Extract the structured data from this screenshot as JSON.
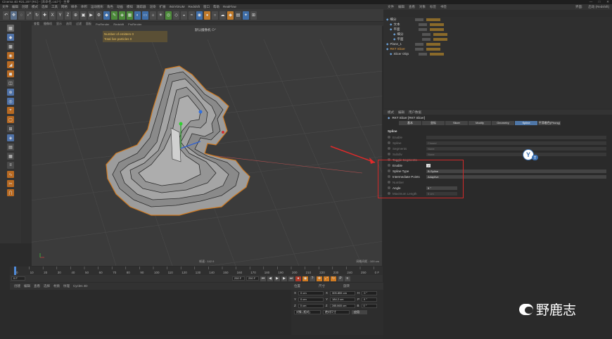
{
  "window": {
    "title": "Cinema 4D R21.207 (RC) - [未命名.c4d *] - 主要",
    "controls": [
      "—",
      "□",
      "✕"
    ]
  },
  "menubar": [
    "文件",
    "编辑",
    "创建",
    "模式",
    "选择",
    "工具",
    "网格",
    "样条",
    "体积",
    "运动图形",
    "角色",
    "动画",
    "模拟",
    "跟踪器",
    "渲染",
    "扩展",
    "INSYDIUM",
    "Redshift",
    "窗口",
    "帮助",
    "RealFlow"
  ],
  "viewport": {
    "menu": [
      "查看",
      "摄像机",
      "显示",
      "选项",
      "过滤",
      "面板",
      "ProRender",
      "Redshift",
      "ProRender"
    ],
    "camera": "默认摄像机 ⊙°",
    "hud": [
      "Number of emitters 0",
      "Total live particles 0"
    ],
    "status": "帧速 : 142.9",
    "grid_spacing": "网格间距 : 100 cm"
  },
  "timeline": {
    "ticks": [
      "0",
      "10",
      "20",
      "30",
      "40",
      "50",
      "60",
      "70",
      "80",
      "90",
      "100",
      "110",
      "120",
      "130",
      "140",
      "150",
      "160",
      "170",
      "180",
      "190",
      "200",
      "210",
      "220",
      "230",
      "240",
      "250",
      "0 F"
    ],
    "start": "0 F",
    "end": "250 F",
    "end2": "250 F"
  },
  "bottom_menu": [
    "创建",
    "编辑",
    "查看",
    "选择",
    "材质",
    "纹理",
    "Cycles 4D"
  ],
  "coords": {
    "headers": [
      "位置",
      "尺寸",
      "旋转"
    ],
    "rows": [
      {
        "axis": "X",
        "pos": "0 cm",
        "size": "305.855 cm",
        "rot_label": "H",
        "rot": "0 °"
      },
      {
        "axis": "Y",
        "pos": "0 cm",
        "size": "184.2 cm",
        "rot_label": "P",
        "rot": "0 °"
      },
      {
        "axis": "Z",
        "pos": "0 cm",
        "size": "285.865 cm",
        "rot_label": "B",
        "rot": "0 °"
      }
    ],
    "mode": "对象 (相对)",
    "size_mode": "绝对尺寸",
    "apply": "应用"
  },
  "right": {
    "top_menu": [
      "文件",
      "编辑",
      "查看",
      "对象",
      "标签",
      "书签"
    ],
    "layout_label": "界面:",
    "layout_value": "启动 (Redshift)",
    "objects": [
      {
        "name": "细分",
        "indent": 0
      },
      {
        "name": "文本",
        "indent": 1
      },
      {
        "name": "平面",
        "indent": 1
      },
      {
        "name": "细分",
        "indent": 2
      },
      {
        "name": "平面",
        "indent": 2
      },
      {
        "name": "Plane_1",
        "indent": 0
      },
      {
        "name": "RKT Slicer",
        "indent": 0,
        "selected": true
      },
      {
        "name": "Slicer Objs",
        "indent": 1
      }
    ],
    "attr_menu": [
      "模式",
      "编辑",
      "用户数据"
    ],
    "attr_title": "RKT Slicer [RKT Slicer]",
    "tabs": [
      "基本",
      "坐标",
      "Slicer",
      "Modify",
      "Geometry",
      "Spline",
      "平滑着色(Phong)"
    ],
    "active_tab": "Spline",
    "section": "Spline",
    "rows_dim": [
      {
        "label": "Enable",
        "value": ""
      },
      {
        "label": "Spline",
        "value": "Closed"
      },
      {
        "label": "Segments",
        "value": "None"
      },
      {
        "label": "Subdiv",
        "value": "None"
      }
    ],
    "toggle_segments": "Toggle Segments",
    "rows_hl": [
      {
        "label": "Enable",
        "value": "✓",
        "on": true
      },
      {
        "label": "Spline Type",
        "value": "B-Spline",
        "on": true
      },
      {
        "label": "Intermediate Points",
        "value": "Adaptive",
        "on": true
      },
      {
        "label": "Number",
        "value": "",
        "on": false
      },
      {
        "label": "Angle",
        "value": "5 °",
        "on": true
      },
      {
        "label": "Maximum Length",
        "value": "5 cm",
        "on": false
      }
    ]
  },
  "watermark": {
    "text": "野鹿志"
  },
  "badge": {
    "letter": "Y",
    "small": "言"
  }
}
